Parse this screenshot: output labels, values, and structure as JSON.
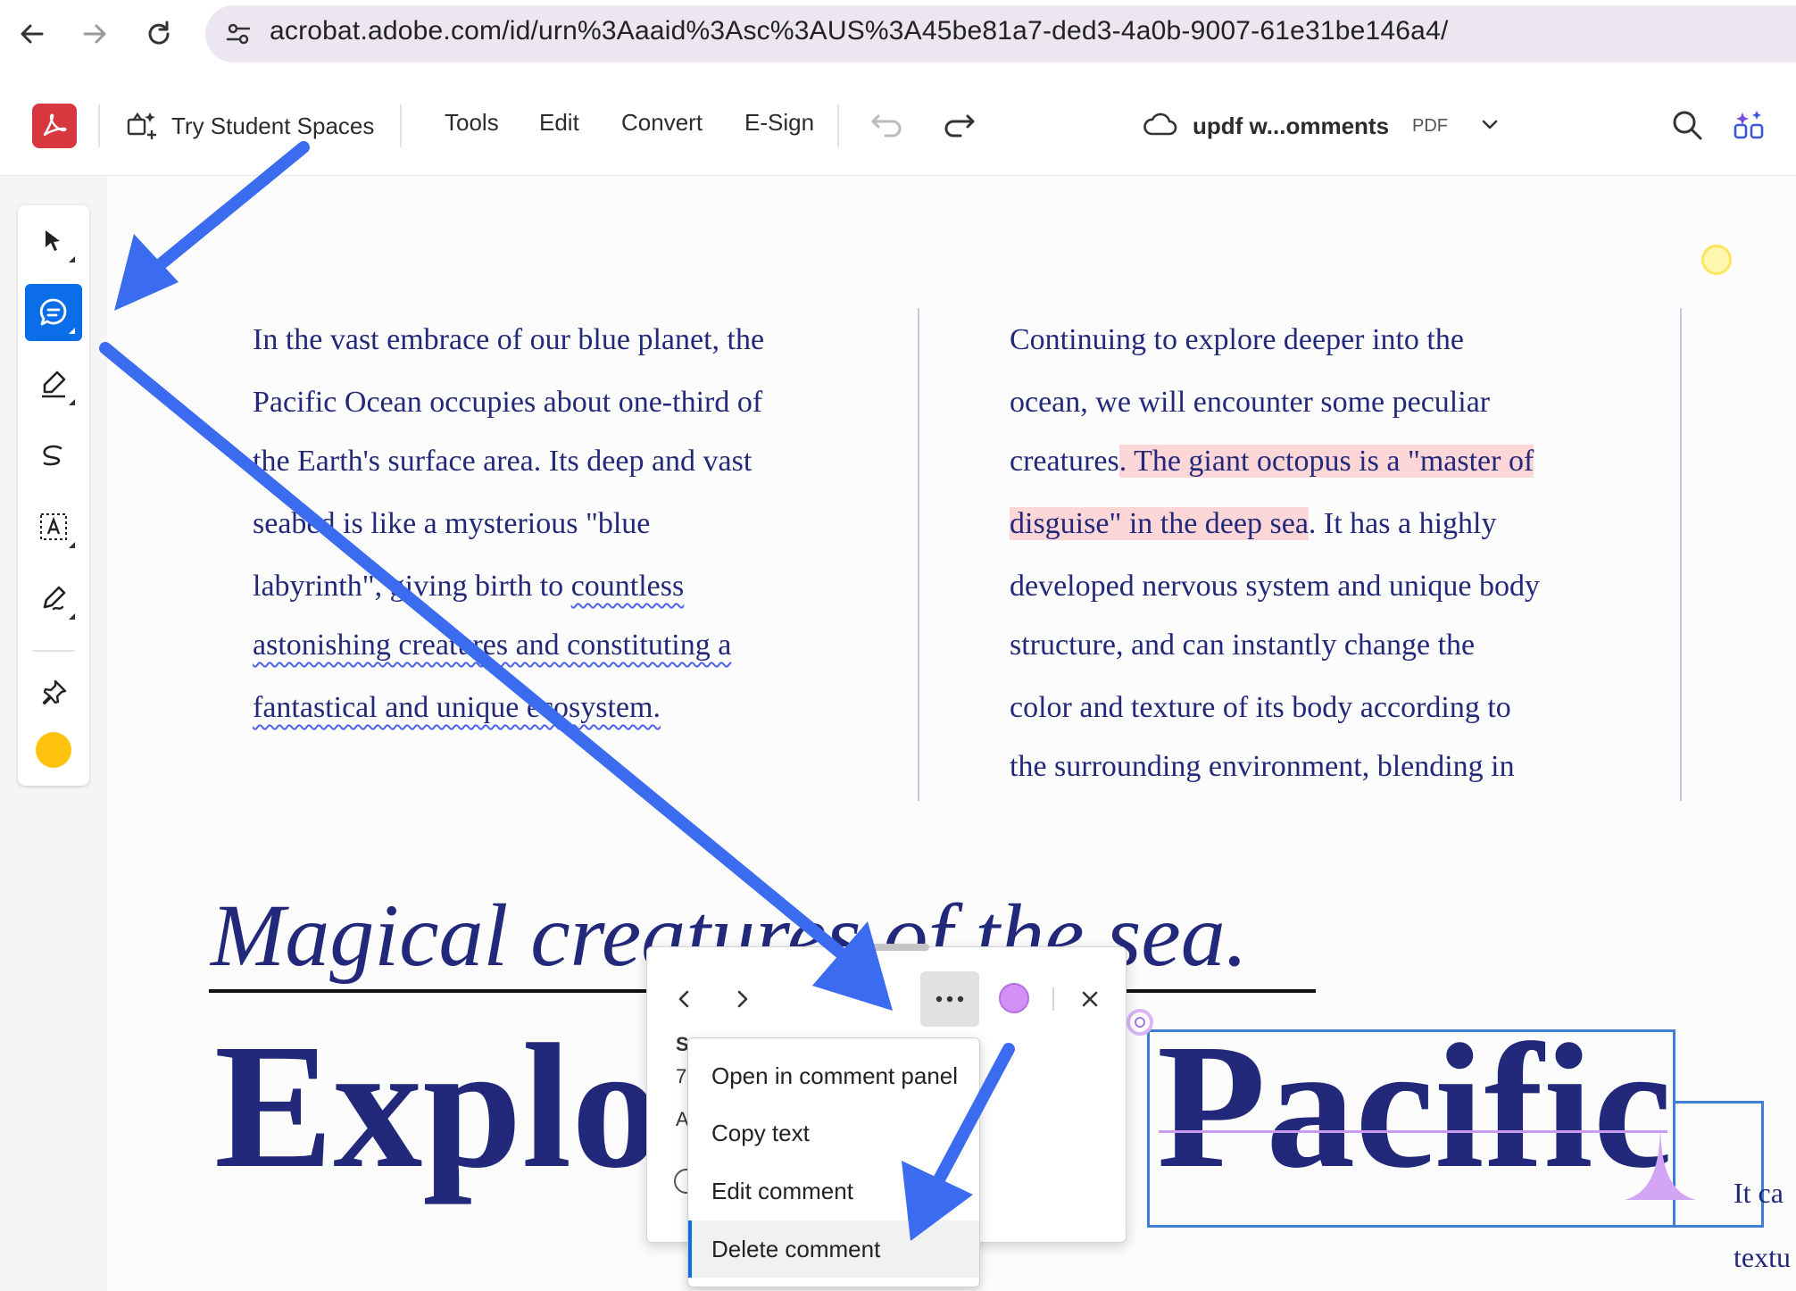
{
  "browser": {
    "url": "acrobat.adobe.com/id/urn%3Aaaid%3Asc%3AUS%3A45be81a7-ded3-4a0b-9007-61e31be146a4/"
  },
  "toolbar": {
    "student_spaces_label": "Try Student Spaces",
    "menu": [
      "Tools",
      "Edit",
      "Convert",
      "E-Sign"
    ],
    "doc_name": "updf w...omments",
    "doc_type": "PDF"
  },
  "document": {
    "left_column_lines": [
      "In the vast embrace of our blue planet, the",
      "Pacific Ocean occupies about one-third of",
      "the Earth's surface area. Its deep and vast",
      "seabed is like a mysterious \"blue",
      "labyrinth\", giving birth to ",
      "countless",
      "astonishing creatures and constituting a",
      "fantastical and unique ecosystem."
    ],
    "right_column_lines": [
      "Continuing to explore deeper into the",
      "ocean, we will encounter some peculiar",
      "creatures",
      ". The giant octopus is a \"master of",
      "disguise\" in the deep sea",
      ". It has a highly",
      "developed nervous system and unique body",
      "structure, and can instantly change the",
      "color and texture of its body according to",
      "the surrounding environment, blending in"
    ],
    "subtitle": "Magical creatures of the sea.",
    "headline_left": "Explo",
    "headline_right": "Pacific",
    "side_text_1": "It ca",
    "side_text_2": "textu"
  },
  "comment_popup": {
    "partial_line_1": "S",
    "partial_line_2": "7",
    "partial_line_3": "A",
    "color": "#d28ff5"
  },
  "context_menu": {
    "items": [
      "Open in comment panel",
      "Copy text",
      "Edit comment",
      "Delete comment"
    ]
  },
  "colors": {
    "accent": "#0b6ee8",
    "doc_text": "#23297a",
    "highlight": "#fdd6d8",
    "annotation_arrow": "#3b6cf0",
    "pen_color": "#ffc20e"
  }
}
